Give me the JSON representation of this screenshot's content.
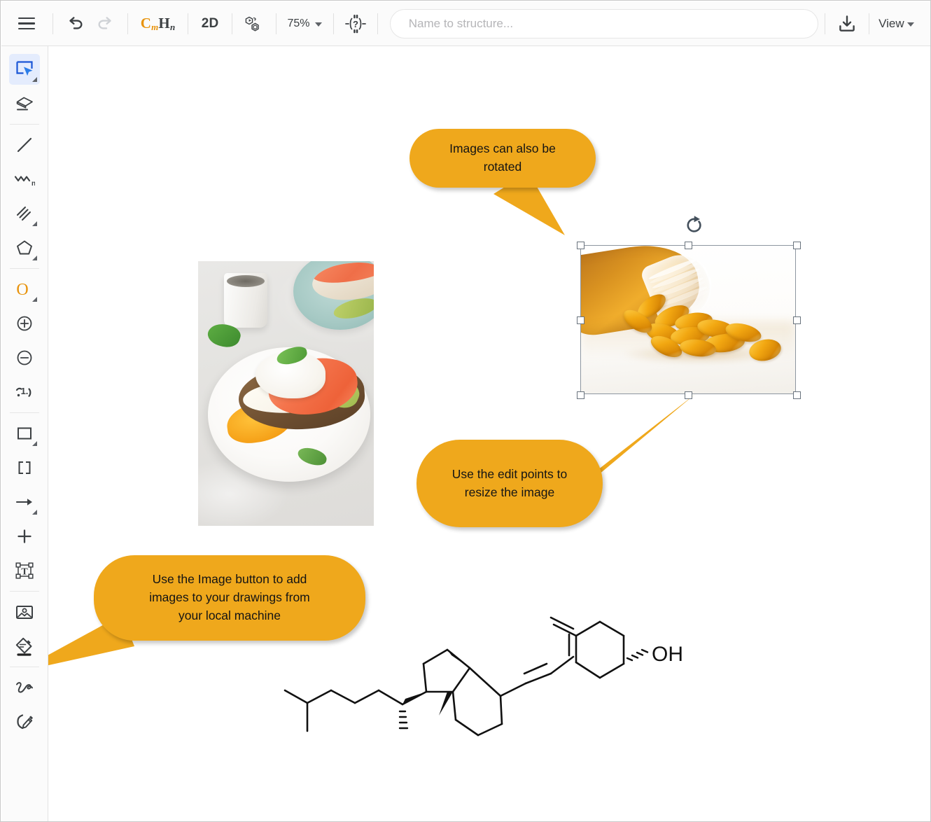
{
  "app": {
    "title": "Chemical structure drawing editor"
  },
  "toolbar": {
    "menu_icon": "hamburger-menu-icon",
    "undo_icon": "undo-arrow-icon",
    "redo_icon": "redo-arrow-icon",
    "formula": {
      "c": "C",
      "sub_m": "m",
      "h": "H",
      "sub_n": "n"
    },
    "formula_label": "CmHn",
    "two_d_label": "2D",
    "cleanup_icon": "structure-cleanup-icon",
    "zoom_level": "75%",
    "query_icon": "query-atom-icon",
    "download_icon": "download-icon",
    "view_label": "View"
  },
  "search": {
    "placeholder": "Name to structure...",
    "value": ""
  },
  "sidebar": {
    "items": [
      {
        "name": "select-tool",
        "icon": "select-rectangle-cursor-icon",
        "active": true,
        "corner": true
      },
      {
        "name": "eraser-tool",
        "icon": "eraser-icon",
        "active": false,
        "corner": false
      },
      {
        "name": "single-bond-tool",
        "icon": "single-bond-line-icon",
        "active": false,
        "corner": false
      },
      {
        "name": "chain-tool",
        "icon": "zigzag-chain-n-icon",
        "active": false,
        "corner": false
      },
      {
        "name": "multi-bond-tool",
        "icon": "triple-bond-icon",
        "active": false,
        "corner": true
      },
      {
        "name": "ring-tool",
        "icon": "pentagon-ring-icon",
        "active": false,
        "corner": true
      },
      {
        "name": "atom-oxygen-tool",
        "icon": "oxygen-atom-o-icon",
        "active": false,
        "corner": true
      },
      {
        "name": "charge-plus-tool",
        "icon": "plus-circle-icon",
        "active": false,
        "corner": false
      },
      {
        "name": "charge-minus-tool",
        "icon": "minus-circle-icon",
        "active": false,
        "corner": false
      },
      {
        "name": "atom-number-tool",
        "icon": "atom-numbering-icon",
        "active": false,
        "corner": false
      },
      {
        "name": "rectangle-tool",
        "icon": "rectangle-shape-icon",
        "active": false,
        "corner": true
      },
      {
        "name": "brackets-tool",
        "icon": "brackets-icon",
        "active": false,
        "corner": false
      },
      {
        "name": "arrow-tool",
        "icon": "reaction-arrow-icon",
        "active": false,
        "corner": true
      },
      {
        "name": "plus-tool",
        "icon": "plus-sign-icon",
        "active": false,
        "corner": false
      },
      {
        "name": "text-tool",
        "icon": "text-box-t-icon",
        "active": false,
        "corner": false
      },
      {
        "name": "image-tool",
        "icon": "image-picture-icon",
        "active": false,
        "corner": false
      },
      {
        "name": "shape-fill-tool",
        "icon": "paint-bucket-icon",
        "active": false,
        "corner": false
      },
      {
        "name": "freehand-tool",
        "icon": "squiggle-freehand-icon",
        "active": false,
        "corner": false
      },
      {
        "name": "pen-tool",
        "icon": "pen-edit-icon",
        "active": false,
        "corner": false
      }
    ],
    "dividers_after": [
      1,
      5,
      9,
      14,
      16
    ]
  },
  "canvas": {
    "callouts": [
      {
        "name": "callout-rotate",
        "text": "Images can also be\nrotated"
      },
      {
        "name": "callout-resize",
        "text": "Use the edit points to\nresize the image"
      },
      {
        "name": "callout-image-button",
        "text": "Use the Image button to add\nimages to your drawings from\nyour local machine"
      }
    ],
    "images": [
      {
        "name": "breakfast-photo",
        "alt": "Salmon avocado poached egg toast on a white plate",
        "selected": false
      },
      {
        "name": "fish-oil-pills-photo",
        "alt": "Amber softgel capsules spilling from a jar",
        "selected": true
      }
    ],
    "selection": {
      "rotate_icon": "rotate-clockwise-icon",
      "handle_count": 8
    },
    "structure": {
      "name": "vitamin-d-cholecalciferol",
      "labels": [
        "OH"
      ]
    }
  },
  "colors": {
    "callout_orange": "#EFA81C",
    "accent_blue": "#1a73e8",
    "active_tool_bg": "#e4ecfd",
    "toolbar_bg": "#fbfbfb",
    "border": "#e2e2e2",
    "text": "#3c4043",
    "handle_stroke": "#69737d",
    "formula_c": "#e8930c"
  }
}
